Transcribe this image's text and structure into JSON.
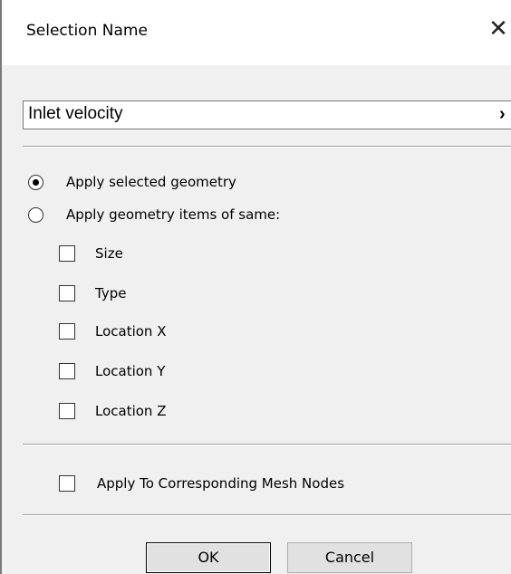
{
  "dialog": {
    "title": "Selection Name",
    "close_glyph": "✕"
  },
  "name_field": {
    "value": "Inlet velocity",
    "chevron": "›"
  },
  "options": {
    "apply_selected": "Apply selected geometry",
    "apply_same": "Apply geometry items of same:",
    "selected_option": "apply_selected",
    "criteria": [
      {
        "label": "Size",
        "checked": false
      },
      {
        "label": "Type",
        "checked": false
      },
      {
        "label": "Location X",
        "checked": false
      },
      {
        "label": "Location Y",
        "checked": false
      },
      {
        "label": "Location Z",
        "checked": false
      }
    ],
    "mesh_nodes": {
      "label": "Apply To Corresponding Mesh Nodes",
      "checked": false
    }
  },
  "buttons": {
    "ok": "OK",
    "cancel": "Cancel"
  }
}
